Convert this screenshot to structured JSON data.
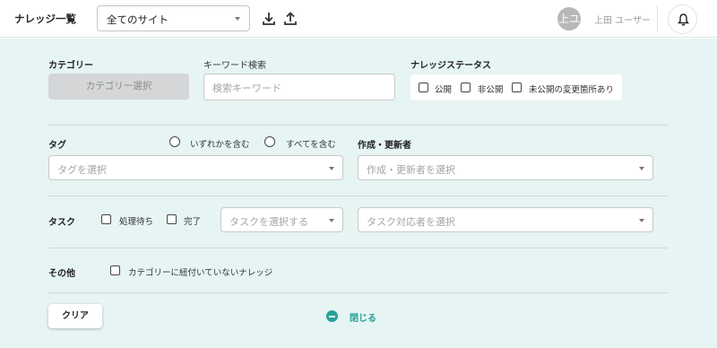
{
  "header": {
    "title": "ナレッジ一覧",
    "site_select": {
      "value": "全てのサイト"
    },
    "download_icon": "download-icon",
    "upload_icon": "upload-icon",
    "user": {
      "avatar_text": "上ユ",
      "name": "上田 ユーザー"
    },
    "bell_icon": "bell-icon"
  },
  "filters": {
    "category": {
      "label": "カテゴリー",
      "button": "カテゴリー選択"
    },
    "keyword": {
      "label": "キーワード検索",
      "placeholder": "検索キーワード"
    },
    "status": {
      "label": "ナレッジステータス",
      "options": [
        "公開",
        "非公開",
        "未公開の変更箇所あり"
      ]
    },
    "tag": {
      "label": "タグ",
      "match_options": [
        "いずれかを含む",
        "すべてを含む"
      ],
      "placeholder": "タグを選択"
    },
    "author": {
      "label": "作成・更新者",
      "placeholder": "作成・更新者を選択"
    },
    "task": {
      "label": "タスク",
      "options": [
        "処理待ち",
        "完了"
      ],
      "task_placeholder": "タスクを選択する",
      "assignee_placeholder": "タスク対応者を選択"
    },
    "other": {
      "label": "その他",
      "option": "カテゴリーに紐付いていないナレッジ"
    },
    "clear_button": "クリア",
    "close_label": "閉じる"
  },
  "colors": {
    "panel_bg": "#e6f4f3",
    "accent": "#2aa198"
  }
}
